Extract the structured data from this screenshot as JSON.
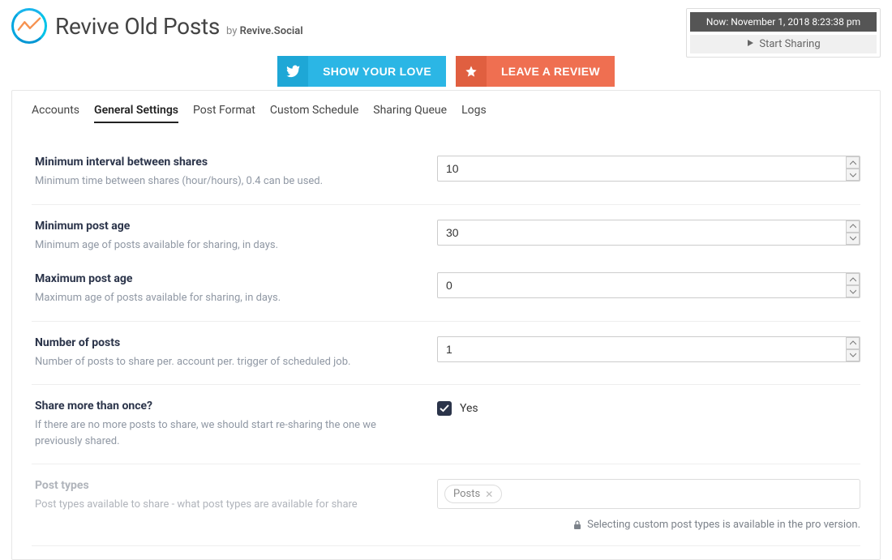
{
  "header": {
    "title": "Revive Old Posts",
    "byline_prefix": "by ",
    "byline_name": "Revive.Social",
    "timestamp": "Now: November 1, 2018 8:23:38 pm",
    "start_sharing": "Start Sharing"
  },
  "cta": {
    "show_love": "SHOW YOUR LOVE",
    "leave_review": "LEAVE A REVIEW"
  },
  "tabs": [
    {
      "label": "Accounts"
    },
    {
      "label": "General Settings"
    },
    {
      "label": "Post Format"
    },
    {
      "label": "Custom Schedule"
    },
    {
      "label": "Sharing Queue"
    },
    {
      "label": "Logs"
    }
  ],
  "fields": {
    "min_interval": {
      "label": "Minimum interval between shares",
      "help": "Minimum time between shares (hour/hours), 0.4 can be used.",
      "value": "10"
    },
    "min_age": {
      "label": "Minimum post age",
      "help": "Minimum age of posts available for sharing, in days.",
      "value": "30"
    },
    "max_age": {
      "label": "Maximum post age",
      "help": "Maximum age of posts available for sharing, in days.",
      "value": "0"
    },
    "num_posts": {
      "label": "Number of posts",
      "help": "Number of posts to share per. account per. trigger of scheduled job.",
      "value": "1"
    },
    "share_more": {
      "label": "Share more than once?",
      "help": "If there are no more posts to share, we should start re-sharing the one we previously shared.",
      "checkbox_label": "Yes"
    },
    "post_types": {
      "label": "Post types",
      "help": "Post types available to share - what post types are available for share",
      "tag": "Posts",
      "pro_note": "Selecting custom post types is available in the pro version."
    }
  }
}
